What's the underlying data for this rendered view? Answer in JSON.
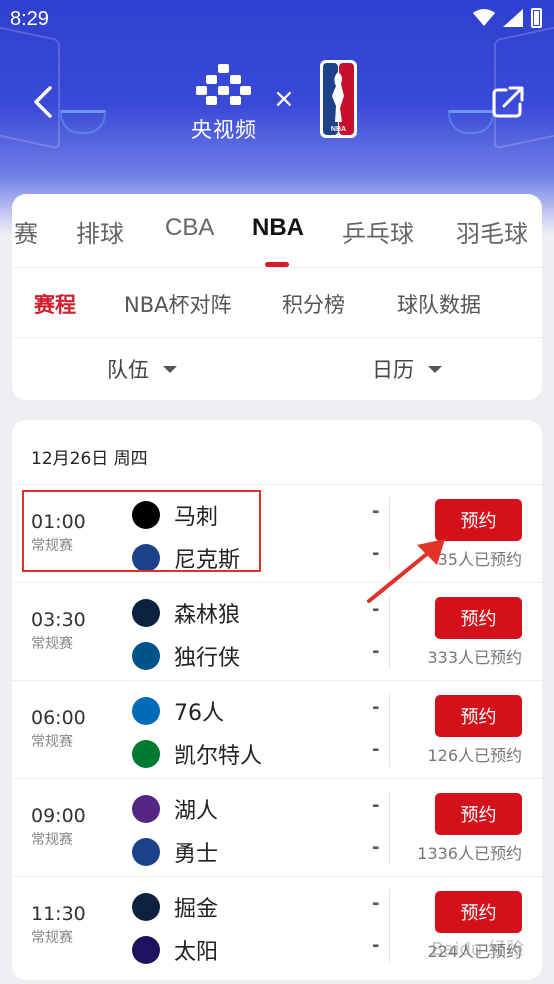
{
  "status_bar": {
    "time": "8:29"
  },
  "header": {
    "brand_name": "央视频",
    "times_sign": "×",
    "partner": "NBA"
  },
  "sport_tabs": [
    {
      "label": "赛",
      "active": false
    },
    {
      "label": "排球",
      "active": false
    },
    {
      "label": "CBA",
      "active": false
    },
    {
      "label": "NBA",
      "active": true
    },
    {
      "label": "乒乓球",
      "active": false
    },
    {
      "label": "羽毛球",
      "active": false
    }
  ],
  "sub_tabs": [
    {
      "label": "赛程",
      "active": true
    },
    {
      "label": "NBA杯对阵",
      "active": false
    },
    {
      "label": "积分榜",
      "active": false
    },
    {
      "label": "球队数据",
      "active": false
    }
  ],
  "filters": {
    "team": "队伍",
    "calendar": "日历"
  },
  "schedule": {
    "date": "12月26日 周四",
    "games": [
      {
        "time": "01:00",
        "type": "常规赛",
        "home": "马刺",
        "away": "尼克斯",
        "home_score": "-",
        "away_score": "-",
        "button": "预约",
        "count": "35人已预约",
        "home_color": "#000000",
        "away_color": "#1d428a"
      },
      {
        "time": "03:30",
        "type": "常规赛",
        "home": "森林狼",
        "away": "独行侠",
        "home_score": "-",
        "away_score": "-",
        "button": "预约",
        "count": "333人已预约",
        "home_color": "#0c2340",
        "away_color": "#00538c"
      },
      {
        "time": "06:00",
        "type": "常规赛",
        "home": "76人",
        "away": "凯尔特人",
        "home_score": "-",
        "away_score": "-",
        "button": "预约",
        "count": "126人已预约",
        "home_color": "#006bb6",
        "away_color": "#007a33"
      },
      {
        "time": "09:00",
        "type": "常规赛",
        "home": "湖人",
        "away": "勇士",
        "home_score": "-",
        "away_score": "-",
        "button": "预约",
        "count": "1336人已预约",
        "home_color": "#552583",
        "away_color": "#1d428a"
      },
      {
        "time": "11:30",
        "type": "常规赛",
        "home": "掘金",
        "away": "太阳",
        "home_score": "-",
        "away_score": "-",
        "button": "预约",
        "count": "224人已预约",
        "home_color": "#0e2240",
        "away_color": "#1d1160"
      }
    ]
  },
  "accent_color": "#d4111b",
  "watermark": "Baidu 经验"
}
